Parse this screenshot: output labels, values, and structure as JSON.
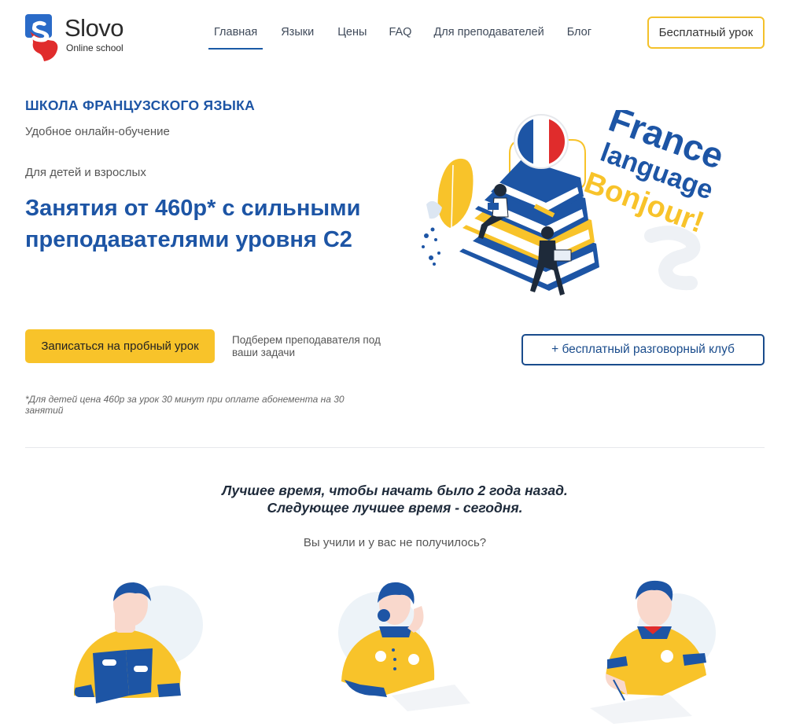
{
  "brand": {
    "name": "Slovo",
    "tagline": "Online school",
    "colors": {
      "primary": "#1d55a5",
      "accent": "#f8c32a",
      "logo_red": "#e02c2c"
    }
  },
  "nav": {
    "items": [
      {
        "label": "Главная",
        "active": true
      },
      {
        "label": "Языки"
      },
      {
        "label": "Цены"
      },
      {
        "label": "FAQ"
      },
      {
        "label": "Для преподавателей"
      },
      {
        "label": "Блог"
      }
    ],
    "cta": "Бесплатный урок"
  },
  "hero": {
    "school": "ШКОЛА ФРАНЦУЗСКОГО ЯЗЫКА",
    "subtitle": "Удобное онлайн-обучение",
    "audience": "Для детей и взрослых",
    "title": "Занятия от 460р* с сильными преподавателями уровня С2",
    "trial_button": "Записаться на пробный урок",
    "trial_note": "Подберем преподавателя под ваши задачи",
    "club_button": "+ бесплатный разговорный клуб",
    "footnote": "*Для детей цена 460р за урок 30 минут при оплате абонемента на 30 занятий"
  },
  "illustration": {
    "line1": "France",
    "line2": "language",
    "line3": "Bonjour!",
    "icons": [
      "france-flag-icon",
      "books-stack-icon",
      "leaf-icon"
    ]
  },
  "section": {
    "quote_line1": "Лучшее время, чтобы начать было 2 года назад.",
    "quote_line2": "Следующее лучшее время - сегодня.",
    "question": "Вы учили и у вас не получилось?"
  }
}
